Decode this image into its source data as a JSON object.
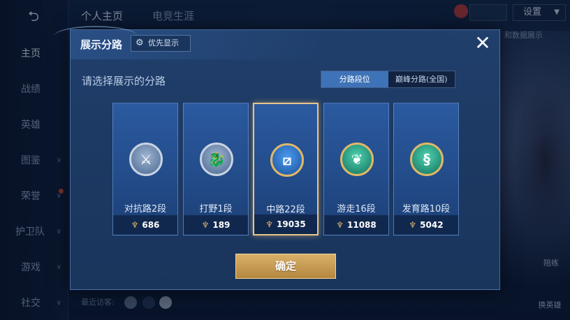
{
  "background": {
    "back_icon": "back-arrow-icon",
    "tabs": [
      {
        "label": "个人主页"
      },
      {
        "label": "电竞生涯"
      }
    ],
    "settings_label": "设置",
    "right_note": "和数据展示",
    "right_buttons": [
      {
        "label": "陪练"
      },
      {
        "label": "换英雄"
      }
    ],
    "visitors_label": "最近访客:"
  },
  "sidebar": {
    "items": [
      {
        "label": "主页",
        "active": true
      },
      {
        "label": "战绩"
      },
      {
        "label": "英雄"
      },
      {
        "label": "图鉴"
      },
      {
        "label": "荣誉"
      },
      {
        "label": "护卫队"
      },
      {
        "label": "游戏"
      },
      {
        "label": "社交"
      }
    ]
  },
  "modal": {
    "title": "展示分路",
    "priority_label": "优先显示",
    "close_icon": "close-icon",
    "subtitle": "请选择展示的分路",
    "segment": [
      {
        "label": "分路段位",
        "active": true
      },
      {
        "label": "巅峰分路(全国)"
      }
    ],
    "cards": [
      {
        "name": "对抗路2段",
        "score": "686",
        "emblem_icon": "clash-lane-icon",
        "selected": false
      },
      {
        "name": "打野1段",
        "score": "189",
        "emblem_icon": "jungle-icon",
        "selected": false
      },
      {
        "name": "中路22段",
        "score": "19035",
        "emblem_icon": "mid-lane-icon",
        "selected": true
      },
      {
        "name": "游走16段",
        "score": "11088",
        "emblem_icon": "roam-icon",
        "selected": false
      },
      {
        "name": "发育路10段",
        "score": "5042",
        "emblem_icon": "farm-lane-icon",
        "selected": false
      }
    ],
    "confirm_label": "确定"
  },
  "colors": {
    "accent_blue": "#3f73b8",
    "gold": "#d9b06a",
    "panel": "#1d3a64"
  }
}
